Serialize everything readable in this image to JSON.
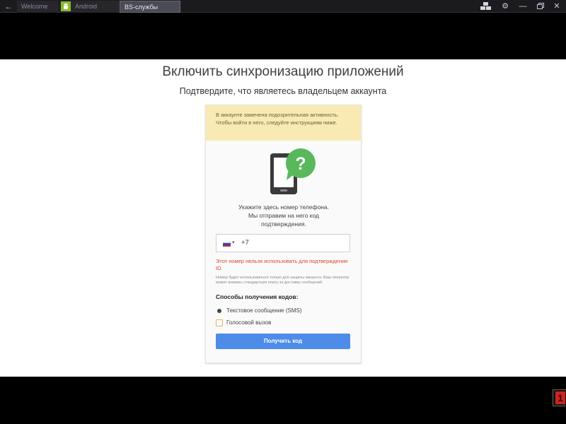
{
  "window": {
    "back_icon": "back-arrow-icon",
    "tabs": [
      {
        "label": "Welcome"
      },
      {
        "label": "Android"
      },
      {
        "label": "BS-службы"
      }
    ],
    "controls": [
      "keyboard-icon",
      "gear-icon",
      "minimize-icon",
      "restore-icon",
      "close-icon"
    ]
  },
  "page": {
    "title": "Включить синхронизацию приложений",
    "subtitle": "Подтвердите, что являетесь владельцем аккаунта"
  },
  "card": {
    "warning": "В аккаунте замечена подозрительная активность. Чтобы войти в него, следуйте инструкциям ниже.",
    "instruction_line1": "Укажите здесь номер телефона.",
    "instruction_line2": "Мы отправим на него код",
    "instruction_line3": "подтверждения.",
    "phone_input": {
      "country_code": "+7",
      "flag": "russia-flag-icon"
    },
    "error": "Этот номер нельзя использовать для подтверждения ID.",
    "fine_print": "Номер будет использоваться только для защиты аккаунта. Ваш оператор может взимать стандартную плату за доставку сообщений.",
    "methods_title": "Способы получения кодов:",
    "option_sms": "Текстовое сообщение (SMS)",
    "option_voice": "Голосовой вызов",
    "submit": "Получить код"
  },
  "colors": {
    "accent_button": "#4d8ce8",
    "warning_bg": "#f8eab2",
    "error_text": "#d9442e",
    "help_bubble": "#58b85b"
  },
  "notification": {
    "badge": "1"
  }
}
